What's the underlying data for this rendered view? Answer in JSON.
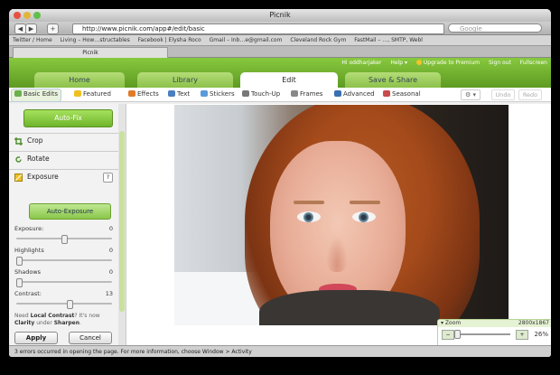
{
  "window": {
    "title": "Picnik"
  },
  "toolbar": {
    "back": "◀",
    "forward": "▶",
    "add": "+",
    "url": "http://www.picnik.com/app#/edit/basic",
    "search_placeholder": "Google"
  },
  "bookmarks": [
    "Twitter / Home",
    "Living – How…structables",
    "Facebook | Elysha Roco",
    "Gmail – Inb…e@gmail.com",
    "Cleveland Rock Gym",
    "FastMail – …, SMTP, Webl"
  ],
  "tab": {
    "label": "Picnik"
  },
  "header": {
    "user": "Hi oddharjaker",
    "help": "Help ▾",
    "upgrade": "Upgrade to Premium",
    "signout": "Sign out",
    "fullscreen": "Fullscreen"
  },
  "main_tabs": [
    {
      "label": "Home",
      "active": false
    },
    {
      "label": "Library",
      "active": false
    },
    {
      "label": "Edit",
      "active": true
    },
    {
      "label": "Save & Share",
      "active": false
    }
  ],
  "subtabs": [
    "Basic Edits",
    "Featured",
    "Effects",
    "Text",
    "Stickers",
    "Touch-Up",
    "Frames",
    "Advanced",
    "Seasonal"
  ],
  "undo": "Undo",
  "redo": "Redo",
  "gear": "⚙ ▾",
  "sidebar": {
    "autofix": "Auto-Fix",
    "items": [
      {
        "label": "Crop"
      },
      {
        "label": "Rotate"
      },
      {
        "label": "Exposure"
      }
    ],
    "help": "?",
    "auto_exposure": "Auto-Exposure",
    "sliders": [
      {
        "label": "Exposure:",
        "value": "0",
        "level": 0.5
      },
      {
        "label": "Highlights",
        "value": "0",
        "level": 0.0
      },
      {
        "label": "Shadows",
        "value": "0",
        "level": 0.0
      },
      {
        "label": "Contrast:",
        "value": "13",
        "level": 0.56
      }
    ],
    "hint_prefix": "Need",
    "hint_bold1": "Local Contrast",
    "hint_mid": "? It's now",
    "hint_bold2": "Clarity",
    "hint_mid2": "under",
    "hint_bold3": "Sharpen",
    "hint_end": ".",
    "apply": "Apply",
    "cancel": "Cancel"
  },
  "zoom": {
    "title": "▾ Zoom",
    "dims": "2800x1867",
    "percent": "26%",
    "minus": "−",
    "plus": "+",
    "level": 0.0
  },
  "status": "3 errors occurred in opening the page. For more information, choose Window > Activity"
}
